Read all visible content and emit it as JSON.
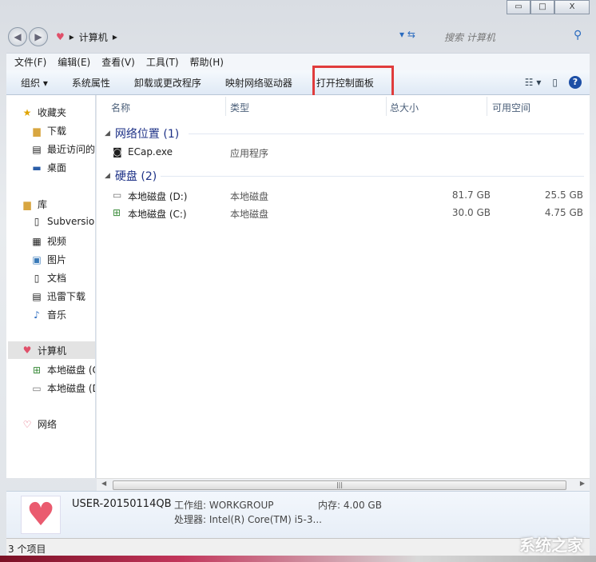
{
  "window": {
    "minimize": "▭",
    "maximize": "□",
    "close": "X"
  },
  "address": {
    "breadcrumb": "计算机",
    "search_placeholder": "搜索 计算机"
  },
  "menu": [
    "文件(F)",
    "编辑(E)",
    "查看(V)",
    "工具(T)",
    "帮助(H)"
  ],
  "toolbar": {
    "organize": "组织 ▾",
    "items": [
      "系统属性",
      "卸载或更改程序",
      "映射网络驱动器",
      "打开控制面板"
    ]
  },
  "sidebar": {
    "favorites": {
      "label": "收藏夹",
      "items": [
        "下载",
        "最近访问的",
        "桌面"
      ]
    },
    "libraries": {
      "label": "库",
      "items": [
        "Subversion",
        "视频",
        "图片",
        "文档",
        "迅雷下载",
        "音乐"
      ]
    },
    "computer": {
      "label": "计算机",
      "items": [
        "本地磁盘 (C",
        "本地磁盘 (D"
      ]
    },
    "network": {
      "label": "网络"
    }
  },
  "columns": [
    "名称",
    "类型",
    "总大小",
    "可用空间"
  ],
  "groups": [
    {
      "title": "网络位置 (1)",
      "rows": [
        {
          "name": "ECap.exe",
          "type": "应用程序",
          "total": "",
          "free": ""
        }
      ]
    },
    {
      "title": "硬盘 (2)",
      "rows": [
        {
          "name": "本地磁盘 (D:)",
          "type": "本地磁盘",
          "total": "81.7 GB",
          "free": "25.5 GB"
        },
        {
          "name": "本地磁盘 (C:)",
          "type": "本地磁盘",
          "total": "30.0 GB",
          "free": "4.75 GB"
        }
      ]
    }
  ],
  "details": {
    "computer_name": "USER-20150114QB",
    "workgroup": "工作组: WORKGROUP",
    "memory": "内存: 4.00 GB",
    "processor": "处理器: Intel(R) Core(TM) i5-3..."
  },
  "status": {
    "count": "3 个项目"
  },
  "watermark": "系统之家"
}
